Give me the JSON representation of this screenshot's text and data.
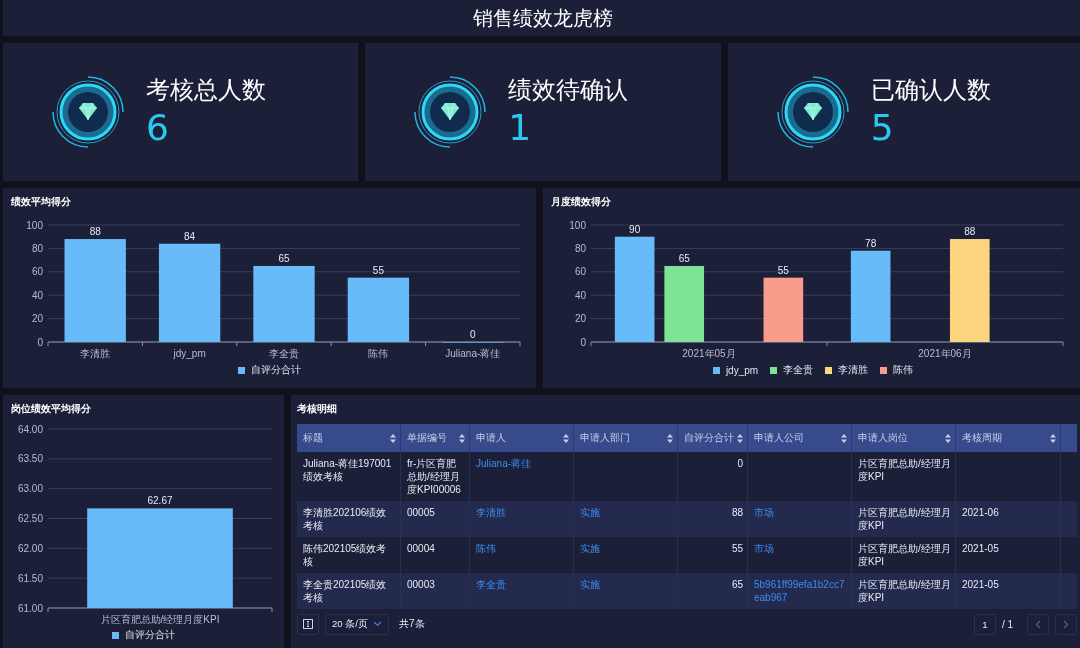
{
  "title": "销售绩效龙虎榜",
  "stats": [
    {
      "label": "考核总人数",
      "value": "6"
    },
    {
      "label": "绩效待确认",
      "value": "1"
    },
    {
      "label": "已确认人数",
      "value": "5"
    }
  ],
  "charts": [
    {
      "title": "绩效平均得分",
      "chart_data": {
        "type": "bar",
        "categories": [
          "李清胜",
          "jdy_pm",
          "李全贵",
          "陈伟",
          "Juliana-蒋佳"
        ],
        "ylim": [
          0,
          100
        ],
        "yticks": [
          0,
          20,
          40,
          60,
          80,
          100
        ],
        "data_labels": true,
        "grid": true,
        "legend": "bottom",
        "series": [
          {
            "name": "自评分合计",
            "color": "#66bbf8",
            "values": [
              88,
              84,
              65,
              55,
              0
            ]
          }
        ]
      }
    },
    {
      "title": "月度绩效得分",
      "chart_data": {
        "type": "bar",
        "categories": [
          "2021年05月",
          "2021年06月"
        ],
        "ylim": [
          0,
          100
        ],
        "yticks": [
          0,
          20,
          40,
          60,
          80,
          100
        ],
        "data_labels": true,
        "grid": true,
        "legend": "bottom",
        "series": [
          {
            "name": "jdy_pm",
            "color": "#66bbf8",
            "values": [
              90,
              78
            ]
          },
          {
            "name": "李全贵",
            "color": "#7ee394",
            "values": [
              65,
              null
            ]
          },
          {
            "name": "李清胜",
            "color": "#fcd581",
            "values": [
              null,
              88
            ]
          },
          {
            "name": "陈伟",
            "color": "#f89d8c",
            "values": [
              55,
              null
            ]
          }
        ]
      }
    },
    {
      "title": "岗位绩效平均得分",
      "chart_data": {
        "type": "bar",
        "categories": [
          "片区育肥总助/经理月度KPI"
        ],
        "ylim": [
          61,
          64
        ],
        "yticks": [
          {
            "value": 61,
            "label": "61.00"
          },
          {
            "value": 61.5,
            "label": "61.50"
          },
          {
            "value": 62,
            "label": "62.00"
          },
          {
            "value": 62.5,
            "label": "62.50"
          },
          {
            "value": 63,
            "label": "63.00"
          },
          {
            "value": 63.5,
            "label": "63.50"
          },
          {
            "value": 64,
            "label": "64.00"
          }
        ],
        "data_labels": true,
        "grid": true,
        "legend": "bottom",
        "series": [
          {
            "name": "自评分合计",
            "color": "#66bbf8",
            "values": [
              62.67
            ]
          }
        ]
      }
    }
  ],
  "table": {
    "title": "考核明细",
    "columns": [
      {
        "label": "标题",
        "kind": "text"
      },
      {
        "label": "单据编号",
        "kind": "text"
      },
      {
        "label": "申请人",
        "kind": "link"
      },
      {
        "label": "申请人部门",
        "kind": "link"
      },
      {
        "label": "自评分合计",
        "kind": "number"
      },
      {
        "label": "申请人公司",
        "kind": "link"
      },
      {
        "label": "申请人岗位",
        "kind": "text"
      },
      {
        "label": "考核周期",
        "kind": "text"
      }
    ],
    "rows": [
      [
        "Juliana-蒋佳197001绩效考核",
        "fr-片区育肥总助/经理月度KPI00006",
        "Juliana-蒋佳",
        null,
        "0",
        null,
        "片区育肥总助/经理月度KPI",
        null
      ],
      [
        "李清胜202106绩效考核",
        "00005",
        "李清胜",
        "实施",
        "88",
        "市场",
        "片区育肥总助/经理月度KPI",
        "2021-06"
      ],
      [
        "陈伟202105绩效考核",
        "00004",
        "陈伟",
        "实施",
        "55",
        "市场",
        "片区育肥总助/经理月度KPI",
        "2021-05"
      ],
      [
        "李全贵202105绩效考核",
        "00003",
        "李全贵",
        "实施",
        "65",
        "5b961ff99efa1b2cc7eab967",
        "片区育肥总助/经理月度KPI",
        "2021-05"
      ]
    ],
    "page_size": "20 条/页",
    "total": "共7条",
    "page": "1",
    "pages": "/ 1"
  }
}
